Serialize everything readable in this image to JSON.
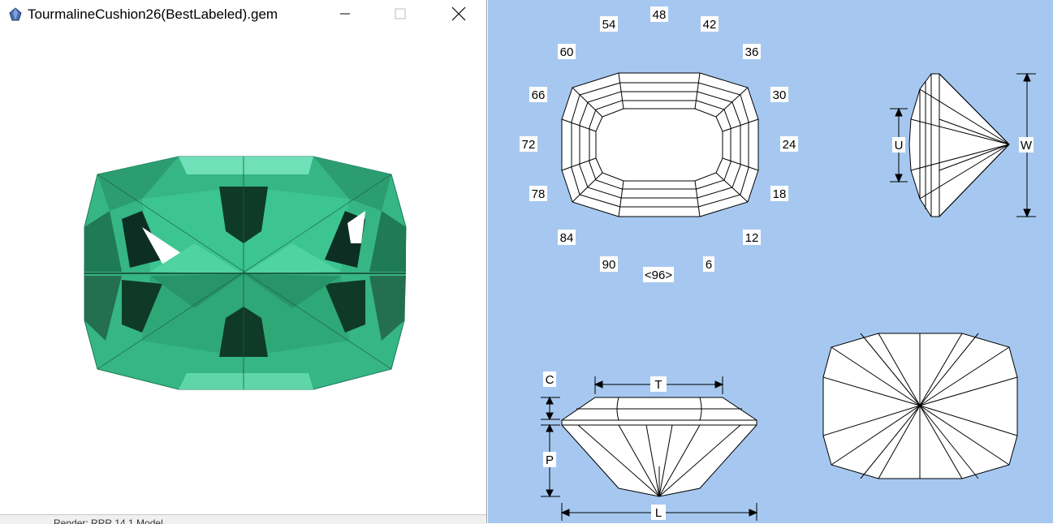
{
  "window": {
    "title": "TourmalineCushion26(BestLabeled).gem",
    "icon": "gem-app-icon",
    "status": "Render: RRR     14.1 Model"
  },
  "controls": {
    "minimize_icon": "minimize-icon",
    "maximize_icon": "maximize-icon",
    "close_icon": "close-icon"
  },
  "render": {
    "gem_color": "#3fbf8a",
    "background": "#ffffff"
  },
  "diagram": {
    "background": "#a6c8f0",
    "index_labels": {
      "i48": "48",
      "i54": "54",
      "i42": "42",
      "i60": "60",
      "i36": "36",
      "i66": "66",
      "i30": "30",
      "i72": "72",
      "i24": "24",
      "i78": "78",
      "i18": "18",
      "i84": "84",
      "i12": "12",
      "i90": "90",
      "i6": "6",
      "i96": "<96>"
    },
    "dimension_labels": {
      "u": "U",
      "w": "W",
      "c": "C",
      "t": "T",
      "p": "P",
      "l": "L"
    }
  }
}
